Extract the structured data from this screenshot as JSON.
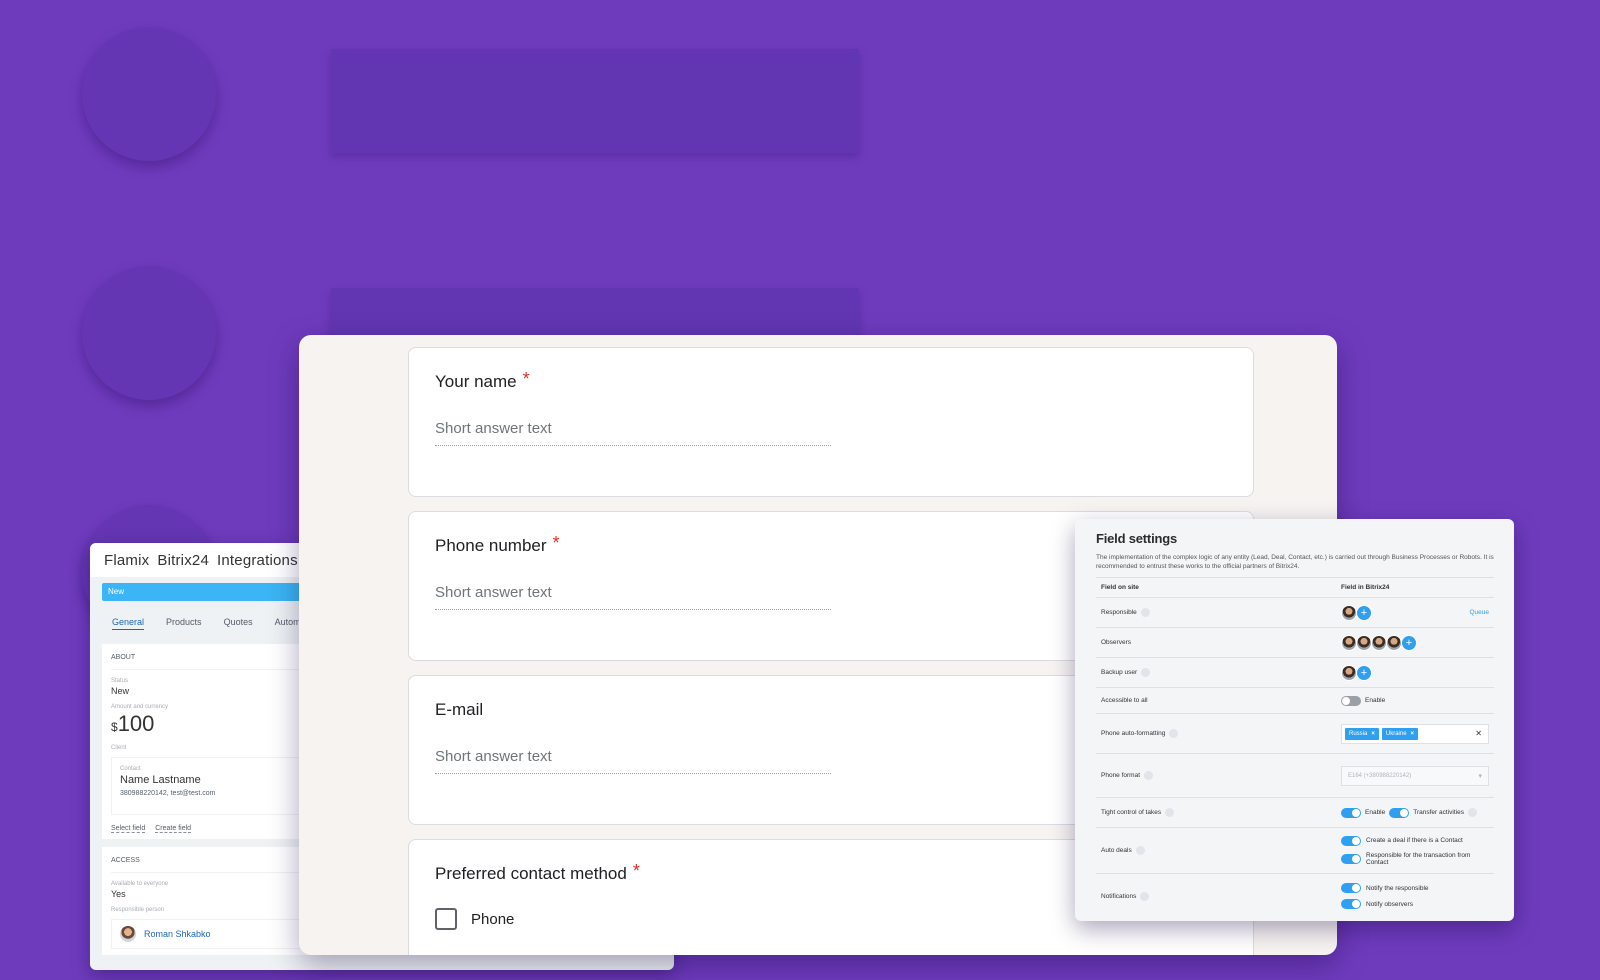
{
  "crm": {
    "brand": "Flamix",
    "product": "Bitrix24",
    "section": "Integrations",
    "status_bar": "New",
    "tabs": [
      "General",
      "Products",
      "Quotes",
      "Automa"
    ],
    "about": {
      "heading": "ABOUT",
      "status_label": "Status",
      "status_value": "New",
      "amount_label": "Amount and currency",
      "currency": "$",
      "amount": "100",
      "client_label": "Client",
      "contact_label": "Contact",
      "contact_name": "Name Lastname",
      "contact_details": "380988220142, test@test.com",
      "select_field": "Select field",
      "create_field": "Create field"
    },
    "access": {
      "heading": "ACCESS",
      "available_label": "Available to everyone",
      "available_value": "Yes",
      "responsible_label": "Responsible person",
      "responsible_name": "Roman Shkabko"
    }
  },
  "form": {
    "questions": [
      {
        "title": "Your name",
        "required": "*",
        "placeholder": "Short answer text"
      },
      {
        "title": "Phone number",
        "required": "*",
        "placeholder": "Short answer text"
      },
      {
        "title": "E-mail",
        "required": "",
        "placeholder": "Short answer text"
      },
      {
        "title": "Preferred contact method",
        "required": "*",
        "option": "Phone"
      }
    ]
  },
  "field_settings": {
    "title": "Field settings",
    "description": "The implementation of the complex logic of any entity (Lead, Deal, Contact, etc.) is carried out through Business Processes or Robots. It is recommended to entrust these works to the official partners of Bitrix24.",
    "col_site": "Field on site",
    "col_bitrix": "Field in Bitrix24",
    "rows": {
      "responsible": "Responsible",
      "queue": "Queue",
      "observers": "Observers",
      "backup_user": "Backup user",
      "accessible": "Accessible to all",
      "accessible_toggle": "Enable",
      "phone_autoformat": "Phone auto-formatting",
      "tags": [
        "Russia",
        "Ukraine"
      ],
      "phone_format": "Phone format",
      "phone_format_value": "E164 (+380988220142)",
      "tight_control": "Tight control of takes",
      "tight_enable": "Enable",
      "transfer_activities": "Transfer activities",
      "auto_deals": "Auto deals",
      "auto_deal_1": "Create a deal if there is a Contact",
      "auto_deal_2": "Responsible for the transaction from Contact",
      "notifications": "Notifications",
      "notify_1": "Notify the responsible",
      "notify_2": "Notify observers"
    }
  },
  "colors": {
    "background": "#6e3bbd",
    "accent_blue": "#2f9ff0",
    "required_red": "#d93025"
  }
}
